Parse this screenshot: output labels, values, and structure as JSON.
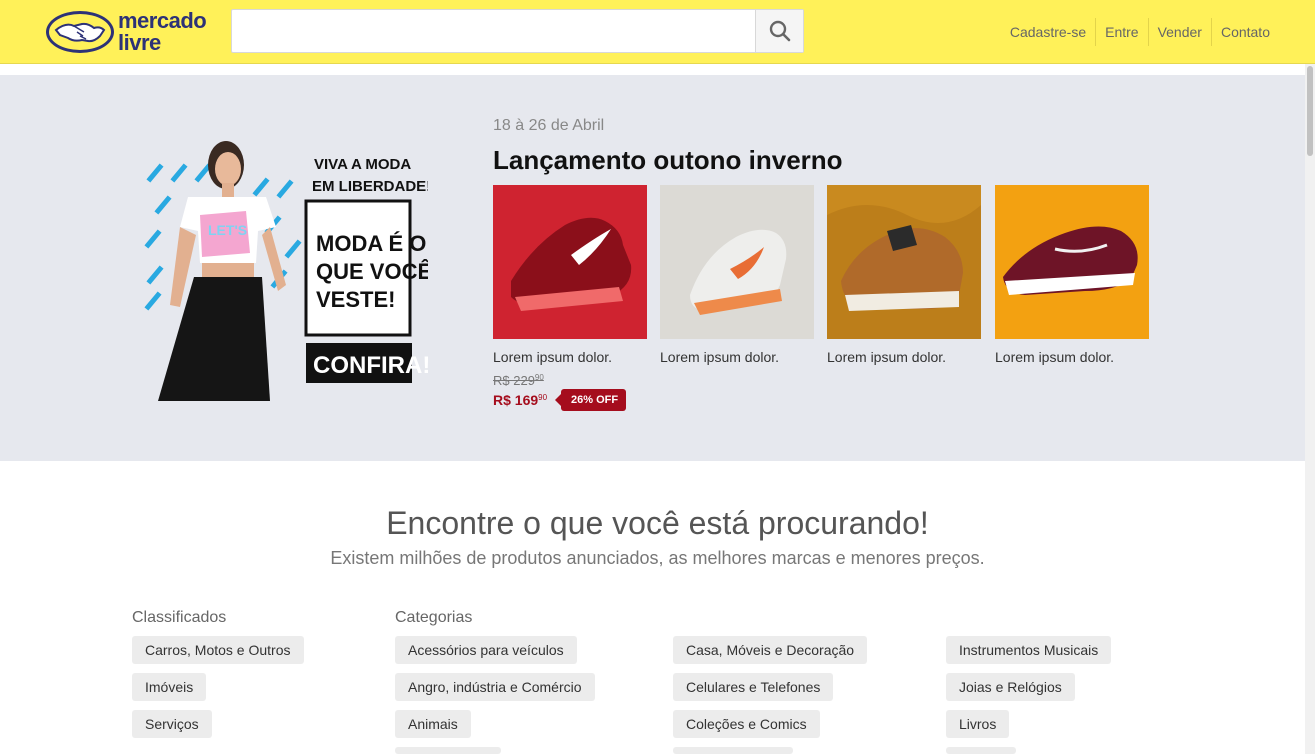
{
  "header": {
    "logo_line1": "mercado",
    "logo_line2": "livre",
    "search_placeholder": "",
    "nav": [
      "Cadastre-se",
      "Entre",
      "Vender",
      "Contato"
    ]
  },
  "banner": {
    "line1": "VIVA A MODA",
    "line2": "EM LIBERDADE!",
    "box_line1": "MODA É O",
    "box_line2": "QUE VOCÊ",
    "box_line3": "VESTE!",
    "cta": "CONFIRA!"
  },
  "hero": {
    "date": "18 à 26 de Abril",
    "title": "Lançamento outono inverno",
    "products": [
      {
        "name": "Lorem ipsum dolor.",
        "color": "#cf2330"
      },
      {
        "name": "Lorem ipsum dolor.",
        "color": "#dcdad5"
      },
      {
        "name": "Lorem ipsum dolor.",
        "color": "#c98a1f"
      },
      {
        "name": "Lorem ipsum dolor.",
        "color": "#f3a111"
      }
    ],
    "old_price": "R$ 229",
    "old_cents": "90",
    "new_price": "R$ 169",
    "new_cents": "90",
    "discount": "26% OFF"
  },
  "find": {
    "title": "Encontre o que você está procurando!",
    "subtitle": "Existem milhões de produtos anunciados, as melhores marcas e menores preços."
  },
  "classificados": {
    "title": "Classificados",
    "items": [
      "Carros, Motos e Outros",
      "Imóveis",
      "Serviços"
    ]
  },
  "categorias": {
    "title": "Categorias",
    "col1": [
      "Acessórios para veículos",
      "Angro, indústria e Comércio",
      "Animais"
    ],
    "col2": [
      "Casa, Móveis e Decoração",
      "Celulares e Telefones",
      "Coleções e Comics"
    ],
    "col3": [
      "Instrumentos Musicais",
      "Joias e Relógios",
      "Livros"
    ]
  },
  "colors": {
    "header_bg": "#fff159",
    "hero_bg": "#e6e8ee",
    "brand_blue": "#2d3277",
    "price_red": "#a50d1d"
  }
}
